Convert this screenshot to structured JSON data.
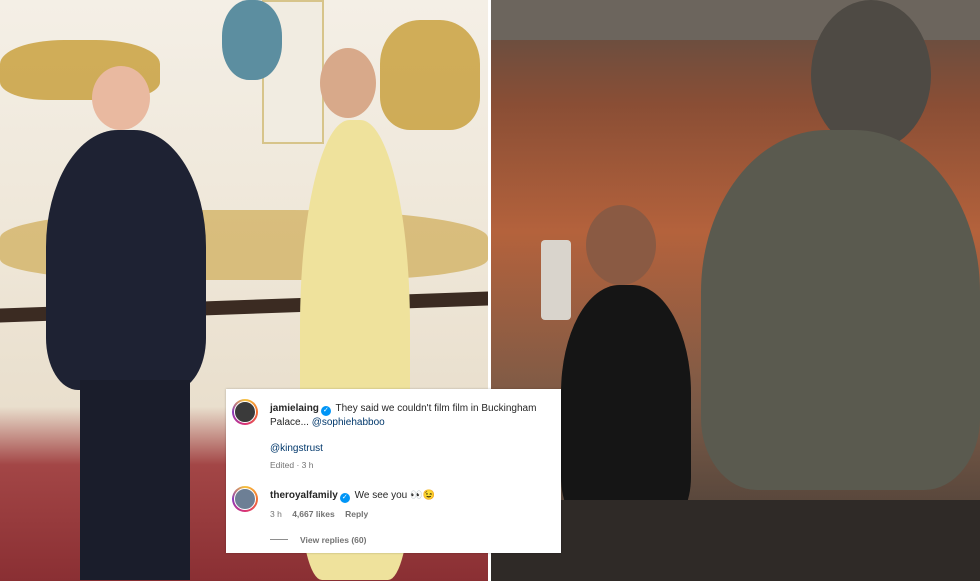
{
  "post": {
    "comments": [
      {
        "username": "jamielaing",
        "text": "They said we couldn't film film in Buckingham",
        "text_line2": "Palace...",
        "mention_1": "@sophiehabboo",
        "mention_2": "@kingstrust",
        "meta": "Edited · 3 h"
      },
      {
        "username": "theroyalfamily",
        "text": "We see you",
        "emoji": "👀😉",
        "time": "3 h",
        "likes": "4,667 likes",
        "reply_label": "Reply",
        "view_replies": "View replies (60)"
      }
    ]
  },
  "icons": {
    "verified": "verified-badge-icon"
  },
  "colors": {
    "verified": "#0095f6",
    "mention": "#00376b",
    "meta": "#737373"
  }
}
